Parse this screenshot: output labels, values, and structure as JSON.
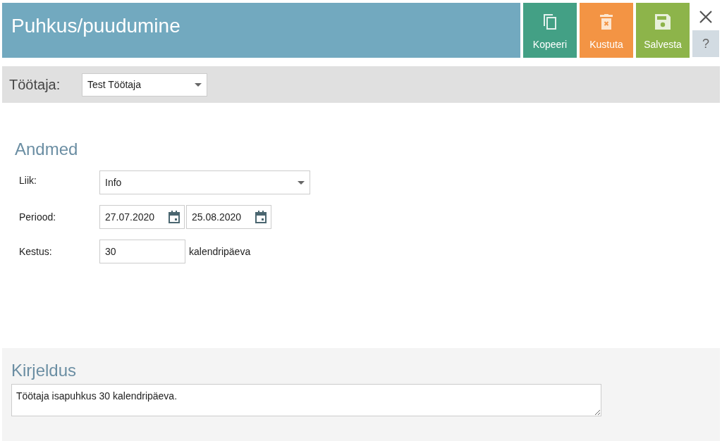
{
  "header": {
    "title": "Puhkus/puudumine",
    "actions": [
      {
        "kind": "copy",
        "label": "Kopeeri"
      },
      {
        "kind": "delete",
        "label": "Kustuta"
      },
      {
        "kind": "save",
        "label": "Salvesta"
      }
    ],
    "help": "?"
  },
  "employee": {
    "label": "Töötaja:",
    "value": "Test Töötaja"
  },
  "details": {
    "heading": "Andmed",
    "type": {
      "label": "Liik:",
      "value": "Info"
    },
    "period": {
      "label": "Periood:",
      "start": "27.07.2020",
      "end": "25.08.2020"
    },
    "duration": {
      "label": "Kestus:",
      "value": "30",
      "unit": "kalendripäeva"
    }
  },
  "description": {
    "heading": "Kirjeldus",
    "value": "Töötaja isapuhkus 30 kalendripäeva."
  }
}
